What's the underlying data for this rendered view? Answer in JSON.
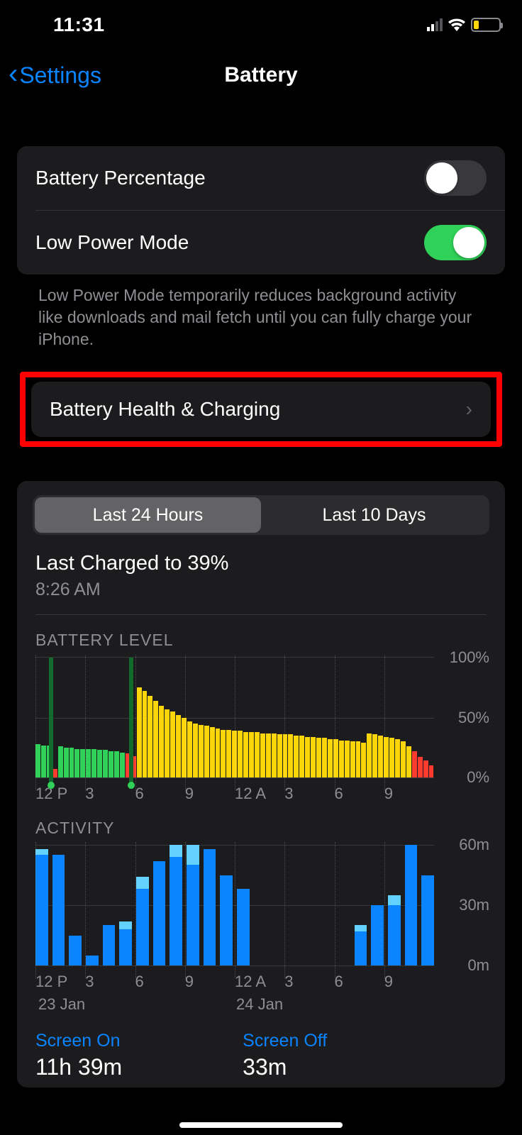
{
  "status": {
    "time": "11:31"
  },
  "nav": {
    "back": "Settings",
    "title": "Battery"
  },
  "cells": {
    "battery_percentage": "Battery Percentage",
    "low_power_mode": "Low Power Mode",
    "battery_health": "Battery Health & Charging"
  },
  "toggles": {
    "battery_percentage": false,
    "low_power_mode": true
  },
  "footer": "Low Power Mode temporarily reduces background activity like downloads and mail fetch until you can fully charge your iPhone.",
  "seg": {
    "a": "Last 24 Hours",
    "b": "Last 10 Days",
    "selected": "a"
  },
  "last_charged": {
    "title": "Last Charged to 39%",
    "sub": "8:26 AM"
  },
  "section_labels": {
    "level": "BATTERY LEVEL",
    "activity": "ACTIVITY"
  },
  "chart_data": {
    "battery_level": {
      "type": "bar",
      "ylabel_ticks": [
        "100%",
        "50%",
        "0%"
      ],
      "ylim": [
        0,
        100
      ],
      "xticks": [
        "12 P",
        "3",
        "6",
        "9",
        "12 A",
        "3",
        "6",
        "9"
      ],
      "values": [
        28,
        27,
        27,
        7,
        26,
        25,
        25,
        24,
        24,
        24,
        24,
        23,
        23,
        22,
        22,
        21,
        20,
        18,
        75,
        72,
        68,
        64,
        60,
        57,
        55,
        52,
        50,
        47,
        45,
        44,
        43,
        42,
        41,
        40,
        40,
        39,
        39,
        38,
        38,
        38,
        37,
        37,
        37,
        36,
        36,
        36,
        35,
        35,
        34,
        34,
        33,
        33,
        32,
        32,
        31,
        31,
        30,
        30,
        29,
        37,
        36,
        35,
        34,
        33,
        32,
        30,
        26,
        22,
        17,
        14,
        10
      ],
      "colors": [
        "green",
        "green",
        "green",
        "red",
        "green",
        "green",
        "green",
        "green",
        "green",
        "green",
        "green",
        "green",
        "green",
        "green",
        "green",
        "green",
        "red",
        "red",
        "yellow",
        "yellow",
        "yellow",
        "yellow",
        "yellow",
        "yellow",
        "yellow",
        "yellow",
        "yellow",
        "yellow",
        "yellow",
        "yellow",
        "yellow",
        "yellow",
        "yellow",
        "yellow",
        "yellow",
        "yellow",
        "yellow",
        "yellow",
        "yellow",
        "yellow",
        "yellow",
        "yellow",
        "yellow",
        "yellow",
        "yellow",
        "yellow",
        "yellow",
        "yellow",
        "yellow",
        "yellow",
        "yellow",
        "yellow",
        "yellow",
        "yellow",
        "yellow",
        "yellow",
        "yellow",
        "yellow",
        "yellow",
        "yellow",
        "yellow",
        "yellow",
        "yellow",
        "yellow",
        "yellow",
        "yellow",
        "yellow",
        "red",
        "red",
        "red",
        "red"
      ],
      "charge_marks_pct": [
        4,
        24
      ]
    },
    "activity": {
      "type": "bar",
      "ylabel_ticks": [
        "60m",
        "30m",
        "0m"
      ],
      "ylim": [
        0,
        60
      ],
      "xticks": [
        "12 P",
        "3",
        "6",
        "9",
        "12 A",
        "3",
        "6",
        "9"
      ],
      "date_labels": [
        "23 Jan",
        "24 Jan"
      ],
      "values": [
        58,
        55,
        15,
        5,
        20,
        22,
        44,
        52,
        60,
        60,
        58,
        45,
        38,
        0,
        0,
        0,
        0,
        0,
        0,
        20,
        30,
        35,
        60,
        45
      ],
      "screen_off_cap": [
        3,
        0,
        0,
        0,
        0,
        4,
        6,
        0,
        6,
        10,
        0,
        0,
        0,
        0,
        0,
        0,
        0,
        0,
        0,
        3,
        0,
        5,
        0,
        0
      ]
    }
  },
  "screen": {
    "on_label": "Screen On",
    "on_val": "11h 39m",
    "off_label": "Screen Off",
    "off_val": "33m"
  }
}
